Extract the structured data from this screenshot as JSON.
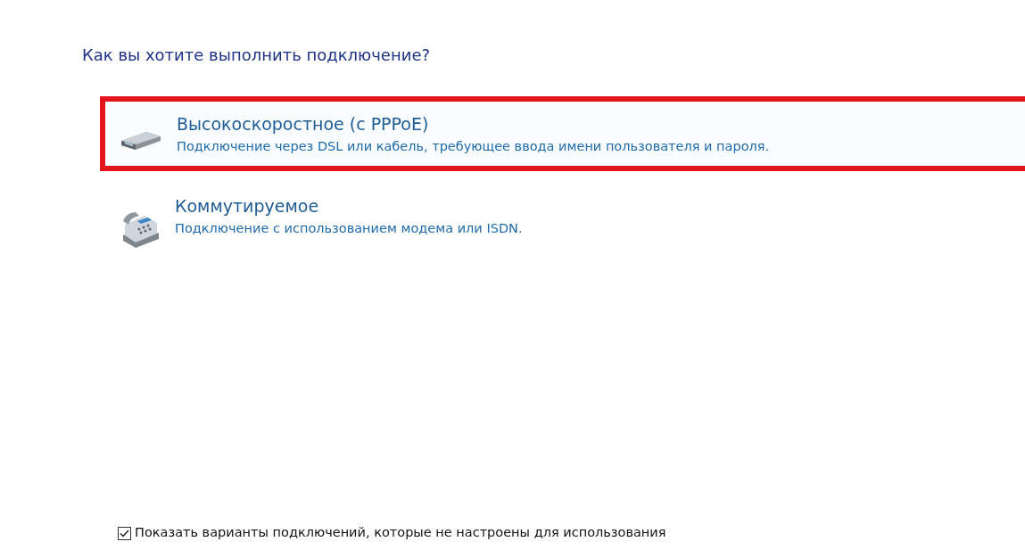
{
  "heading": "Как вы хотите выполнить подключение?",
  "options": [
    {
      "kind": "broadband",
      "title": "Высокоскоростное (с PPPoE)",
      "description": "Подключение через DSL или кабель, требующее ввода имени пользователя и пароля.",
      "highlighted": true
    },
    {
      "kind": "dialup",
      "title": "Коммутируемое",
      "description": "Подключение с использованием модема или ISDN.",
      "highlighted": false
    }
  ],
  "show_all": {
    "label": "Показать варианты подключений, которые не настроены для использования",
    "checked": true
  }
}
